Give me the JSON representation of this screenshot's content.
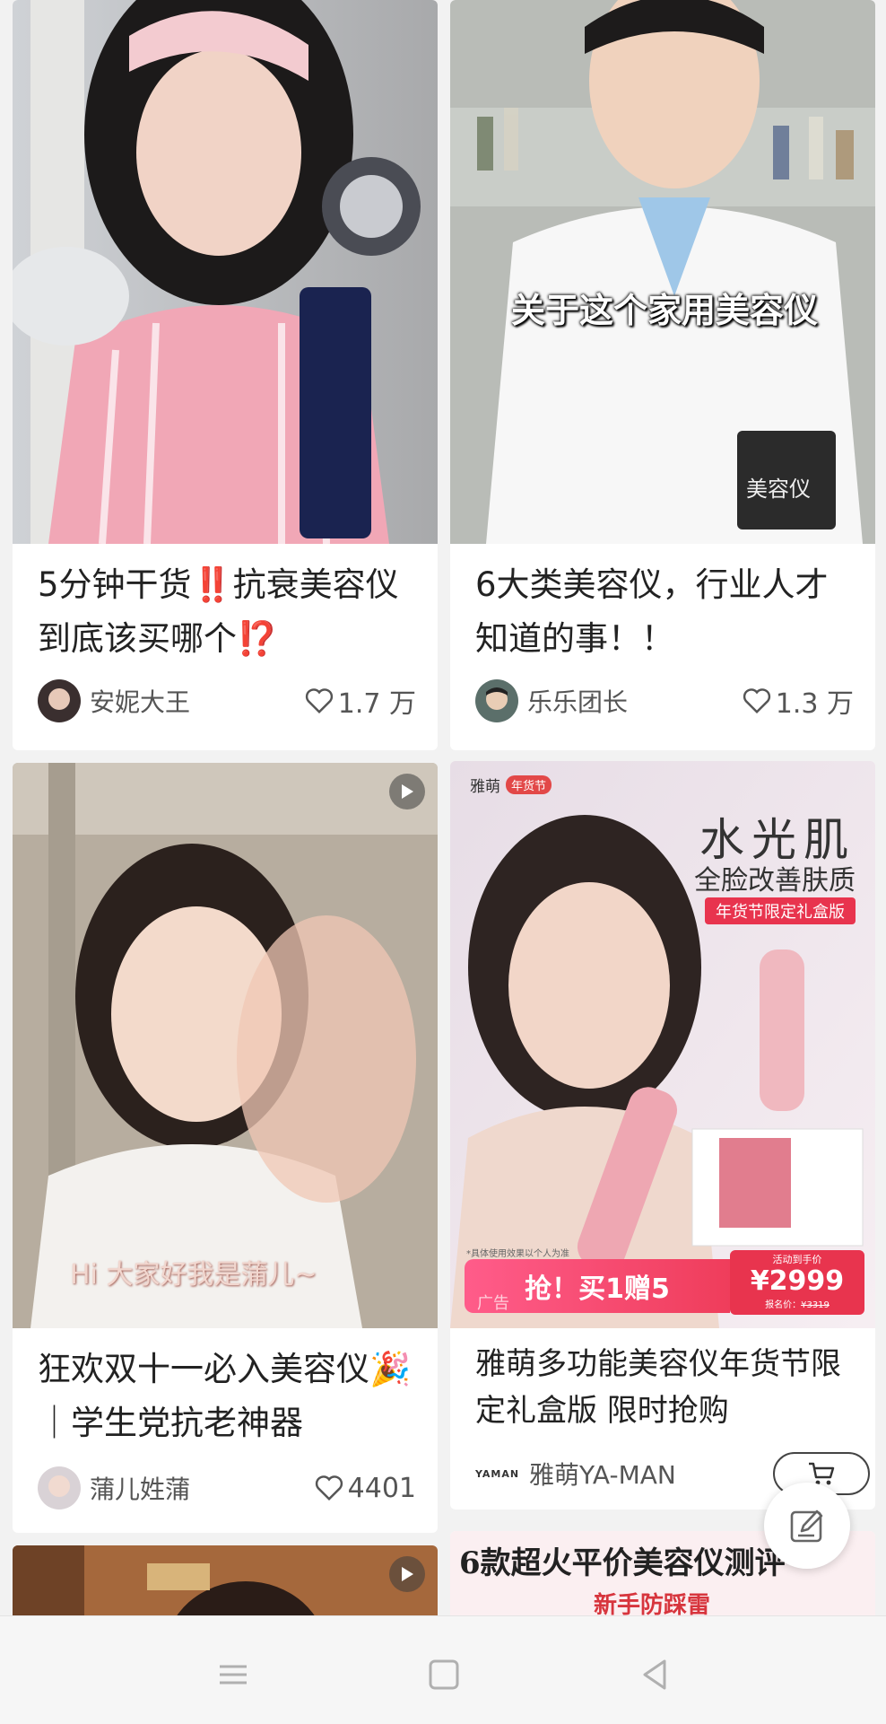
{
  "feed": {
    "cards": [
      {
        "title": "5分钟干货‼️抗衰美容仪 到底该买哪个⁉️",
        "author": "安妮大王",
        "likes": "1.7 万"
      },
      {
        "title": "6大类美容仪，行业人才知道的事！！",
        "author": "乐乐团长",
        "likes": "1.3 万",
        "caption": "关于这个家用美容仪",
        "sign_text": "美容仪"
      },
      {
        "title": "狂欢双十一必入美容仪🎉｜学生党抗老神器",
        "author": "蒲儿姓蒲",
        "likes": "4401",
        "caption": "Hi 大家好我是蒲儿~"
      },
      {
        "title": "雅萌多功能美容仪年货节限定礼盒版 限时抢购",
        "author": "雅萌YA-MAN",
        "brand_logo": "YAMAN",
        "ad_label": "广告",
        "ad": {
          "brand": "雅萌",
          "brand_sub": "YA-MAN",
          "badge": "年货节",
          "headline": "水光肌",
          "subheadline": "全脸改善肤质",
          "tag": "年货节限定礼盒版",
          "cta": "抢！买1赠5",
          "price_label": "活动到手价",
          "price": "¥2999",
          "orig_price_label": "报名价：",
          "orig_price": "¥3319",
          "disclaimer": "*具体使用效果以个人为准"
        }
      },
      {
        "partial": true
      },
      {
        "partial": true,
        "banner_title": "6款超火平价美容仪测评",
        "banner_sub": "新手防踩雷"
      }
    ]
  },
  "icons": {
    "like": "heart-outline-icon",
    "play": "play-icon",
    "cart": "cart-icon",
    "compose": "compose-icon"
  },
  "colors": {
    "background": "#f2f2f2",
    "card": "#ffffff",
    "text": "#222222",
    "muted": "#555555",
    "accent_red": "#e8344e"
  }
}
